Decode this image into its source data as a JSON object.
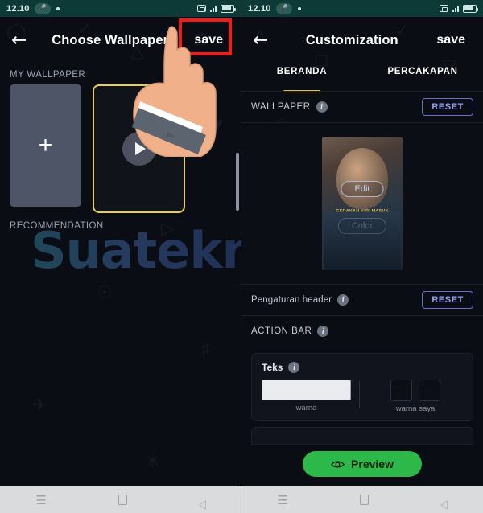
{
  "status_bar": {
    "time": "12.10",
    "mic_icon": "microphone-icon",
    "right_icons": [
      "rotation-icon",
      "signal-icon",
      "battery-icon"
    ]
  },
  "left_screen": {
    "app_bar": {
      "back_icon": "back-arrow-icon",
      "title": "Choose Wallpaper",
      "save_label": "save",
      "highlight_color": "#f01b1b"
    },
    "my_wallpaper_label": "MY WALLPAPER",
    "recommendation_label": "RECOMMENDATION",
    "add_tile_icon": "plus-icon",
    "video_tile": {
      "play_icon": "play-icon",
      "selected": true,
      "selection_color": "#e8cf52"
    }
  },
  "right_screen": {
    "app_bar": {
      "back_icon": "back-arrow-icon",
      "title": "Customization",
      "save_label": "save"
    },
    "tabs": [
      {
        "label": "BERANDA",
        "active": true
      },
      {
        "label": "PERCAKAPAN",
        "active": false
      }
    ],
    "tab_indicator_color": "#d8bd5a",
    "sections": [
      {
        "title": "WALLPAPER",
        "info_icon": "info-icon",
        "reset_label": "RESET"
      },
      {
        "title": "Pengaturan header",
        "info_icon": "info-icon",
        "reset_label": "RESET"
      },
      {
        "title": "ACTION BAR",
        "info_icon": "info-icon"
      }
    ],
    "wallpaper_preview": {
      "edit_label": "Edit",
      "color_label": "Color",
      "caption": "GERAKAN KIRI MASUK"
    },
    "action_bar_card": {
      "field_label": "Teks",
      "info_icon": "info-icon",
      "color_caption": "warna",
      "swatch_caption": "warna saya",
      "input_value": ""
    },
    "partial_section": {
      "title": ""
    },
    "preview_button": {
      "label": "Preview",
      "icon": "eye-icon",
      "color": "#2db84a"
    }
  },
  "watermark": {
    "text": "Suatekno"
  },
  "nav_bar": {
    "menu_icon": "menu-icon",
    "home_icon": "home-icon",
    "back_icon": "back-triangle-icon"
  }
}
